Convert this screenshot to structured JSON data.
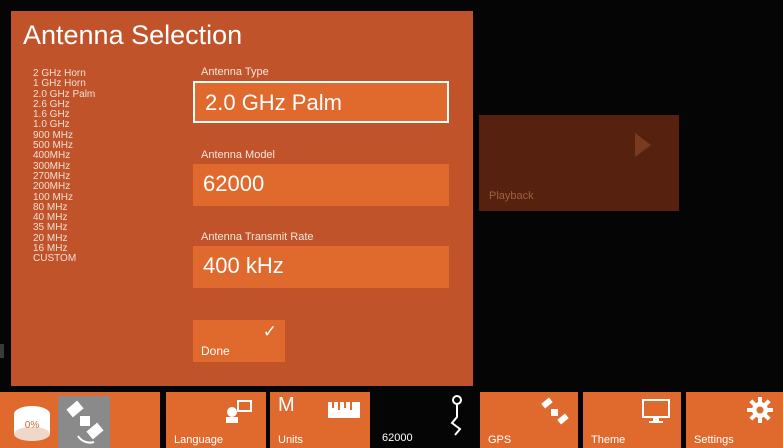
{
  "panel": {
    "title": "Antenna Selection",
    "antenna_list": [
      "2 GHz Horn",
      "1 GHz Horn",
      "2.0 GHz Palm",
      "2.6 GHz",
      "1.6 GHz",
      "1.0 GHz",
      "900 MHz",
      "500 MHz",
      "400MHz",
      "300MHz",
      "270MHz",
      "200MHz",
      "100 MHz",
      "80 MHz",
      "40 MHz",
      "35 MHz",
      "20 MHz",
      "16 MHz",
      "CUSTOM"
    ],
    "antenna_type": {
      "label": "Antenna Type",
      "value": "2.0 GHz Palm"
    },
    "antenna_model": {
      "label": "Antenna Model",
      "value": "62000"
    },
    "transmit_rate": {
      "label": "Antenna Transmit Rate",
      "value": "400 kHz"
    },
    "done_label": "Done"
  },
  "preview": {
    "label": "Playback"
  },
  "taskbar": {
    "language_label": "Language",
    "units_label": "Units",
    "units_letter": "M",
    "model_readout": "62000",
    "gps_label": "GPS",
    "theme_label": "Theme",
    "settings_label": "Settings",
    "status_percent": "0%"
  },
  "colors": {
    "panel": "#c1532a",
    "tile": "#e0692e",
    "background": "#050505"
  }
}
